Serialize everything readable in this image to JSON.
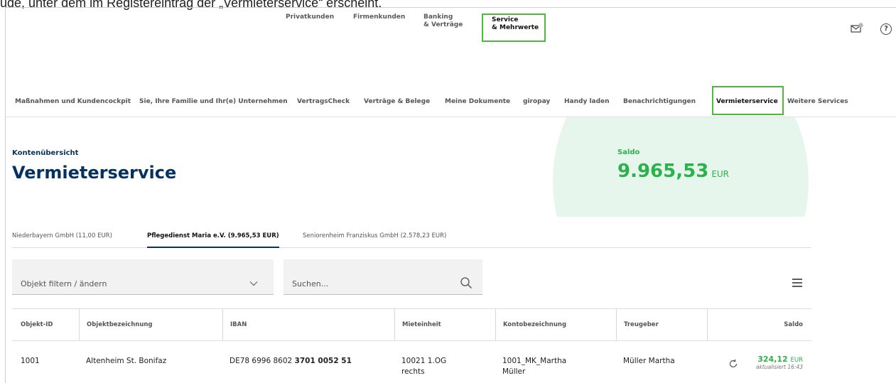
{
  "caption": "ude, unter dem im Registereintrag der „Vermieterservice“ erscheint.",
  "top_nav": {
    "items": [
      {
        "label": "Privatkunden",
        "sub": ""
      },
      {
        "label": "Firmenkunden",
        "sub": ""
      },
      {
        "label": "Banking",
        "sub": "& Verträge"
      },
      {
        "label": "Service",
        "sub": "& Mehrwerte"
      }
    ],
    "help_glyph": "?"
  },
  "sub_nav": {
    "items": [
      "Maßnahmen und Kundencockpit",
      "Sie, Ihre Familie und Ihr(e) Unternehmen",
      "VertragsCheck",
      "Verträge & Belege",
      "Meine Dokumente",
      "giropay",
      "Handy laden",
      "Benachrichtigungen",
      "Vermieterservice",
      "Weitere Services"
    ]
  },
  "header": {
    "breadcrumb": "Kontenübersicht",
    "title": "Vermieterservice",
    "saldo_label": "Saldo",
    "saldo_value": "9.965,53",
    "saldo_currency": "EUR"
  },
  "account_tabs": [
    "Niederbayern GmbH (11,00 EUR)",
    "Pflegedienst Maria e.V. (9.965,53 EUR)",
    "Seniorenheim Franziskus GmbH (2.578,23 EUR)"
  ],
  "filter": {
    "placeholder": "Objekt filtern / ändern"
  },
  "search": {
    "placeholder": "Suchen..."
  },
  "table": {
    "headers": [
      "Objekt-ID",
      "Objektbezeichnung",
      "IBAN",
      "Mieteinheit",
      "Kontobezeichnung",
      "Treugeber",
      "Saldo"
    ],
    "row": {
      "id": "1001",
      "name": "Altenheim St. Bonifaz",
      "iban_prefix": "DE78 6996 8602 ",
      "iban_bold": "3701 0052 51",
      "unit_line1": "10021 1.OG",
      "unit_line2": "rechts",
      "account_line1": "1001_MK_Martha",
      "account_line2": "Müller",
      "trustor": "Müller Martha",
      "saldo": "324,12",
      "saldo_currency": "EUR",
      "updated": "aktualisiert 16:43"
    }
  },
  "colors": {
    "accent_green": "#2bb24c",
    "navy": "#06325f",
    "highlight": "#4cbb3a"
  }
}
